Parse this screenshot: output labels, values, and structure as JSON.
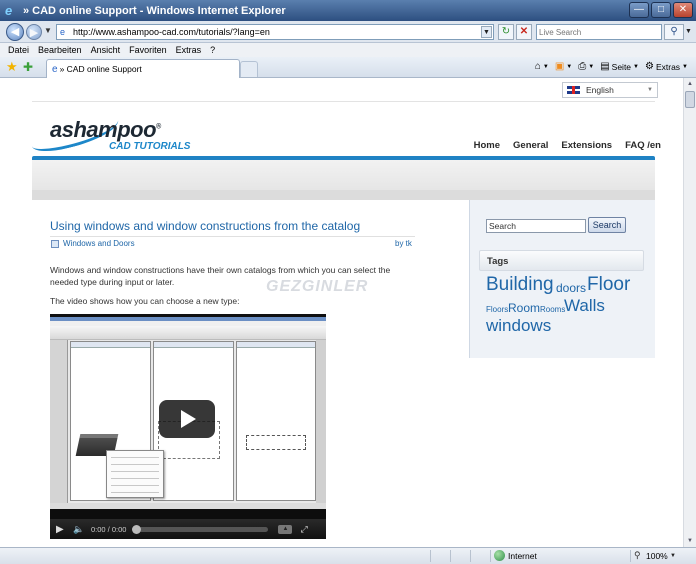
{
  "window": {
    "title": "» CAD online Support - Windows Internet Explorer",
    "icon": "ie-icon"
  },
  "address": {
    "url": "http://www.ashampoo-cad.com/tutorials/?lang=en",
    "search_placeholder": "Live Search"
  },
  "menu": [
    "Datei",
    "Bearbeiten",
    "Ansicht",
    "Favoriten",
    "Extras",
    "?"
  ],
  "tab": {
    "label": "» CAD online Support"
  },
  "commandbar": {
    "page_label": "Seite",
    "tools_label": "Extras"
  },
  "page": {
    "language": "English",
    "logo": {
      "brand": "ashampoo",
      "mark": "®",
      "sub": "CAD TUTORIALS"
    },
    "nav": [
      "Home",
      "General",
      "Extensions",
      "FAQ /en"
    ],
    "post": {
      "title": "Using windows and window constructions from the catalog",
      "category": "Windows and Doors",
      "byline": "by tk",
      "para1": "Windows and window constructions have their own catalogs from which you can select the needed type during input or later.",
      "para2": "The video shows how you can  choose a new type:",
      "watermark": "GEZGINLER"
    },
    "video": {
      "time": "0:00 / 0:00"
    },
    "sidebar": {
      "search_value": "Search",
      "search_button": "Search",
      "tags_heading": "Tags",
      "tags": [
        "Building",
        "doors",
        "Floor",
        "Floors",
        "Room",
        "Rooms",
        "Walls",
        "windows"
      ]
    }
  },
  "status": {
    "zone": "Internet",
    "zoom": "100%"
  },
  "colors": {
    "accent_blue": "#1f82c4",
    "link_blue": "#2067a8",
    "titlebar": "#2d4f80"
  }
}
